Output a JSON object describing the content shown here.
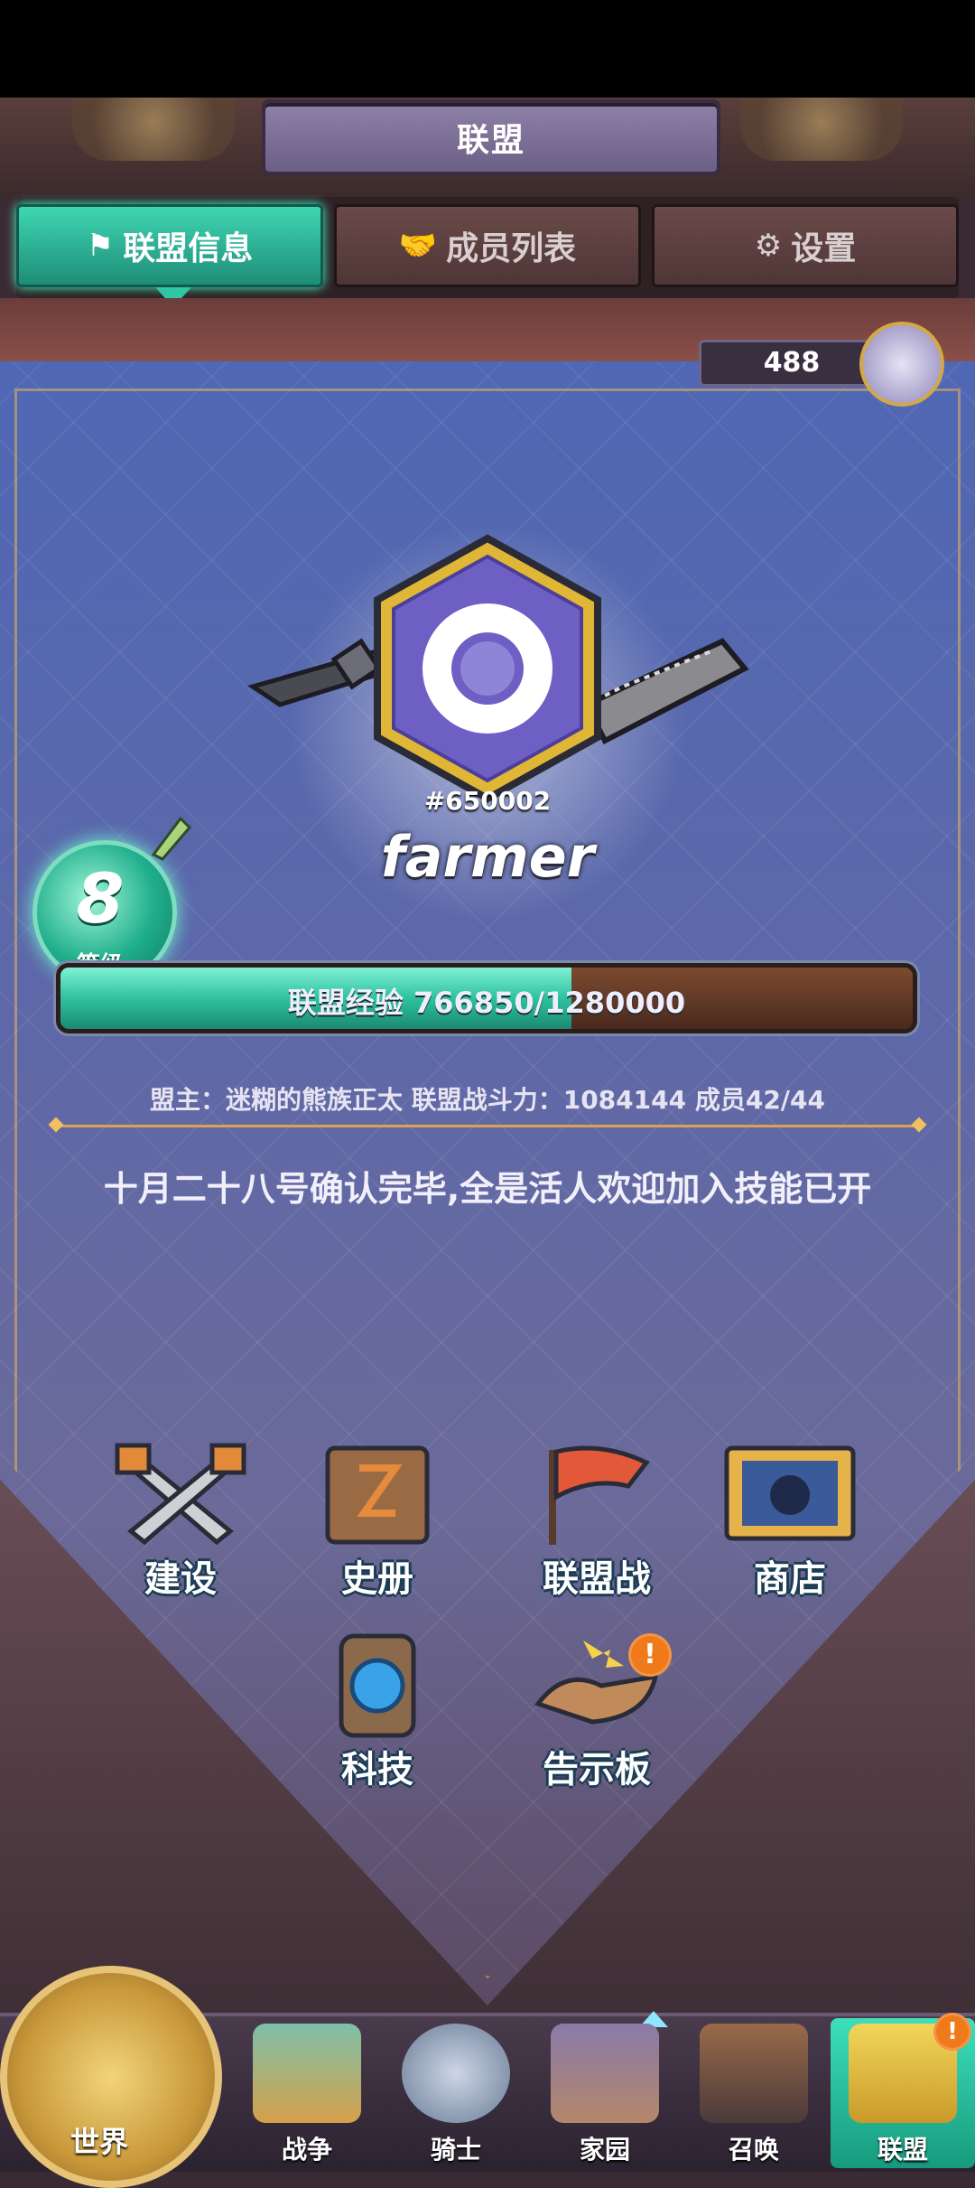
{
  "header": {
    "title": "联盟"
  },
  "tabs": [
    {
      "label": "联盟信息",
      "icon": "flag-icon",
      "active": true
    },
    {
      "label": "成员列表",
      "icon": "handshake-icon",
      "active": false
    },
    {
      "label": "设置",
      "icon": "gear-icon",
      "active": false
    }
  ],
  "score": {
    "value": "488"
  },
  "alliance": {
    "emblem_id": "#650002",
    "name": "farmer",
    "level": "8",
    "level_label": "等级",
    "xp_label": "联盟经验 766850/1280000",
    "xp_current": 766850,
    "xp_max": 1280000,
    "info_line": "盟主：迷糊的熊族正太  联盟战斗力：1084144  成员42/44",
    "announcement": "十月二十八号确认完毕,全是活人欢迎加入技能已开"
  },
  "features": [
    {
      "label": "建设",
      "icon": "build-tools-icon"
    },
    {
      "label": "史册",
      "icon": "history-book-icon"
    },
    {
      "label": "联盟战",
      "icon": "war-flag-icon"
    },
    {
      "label": "商店",
      "icon": "shop-icon"
    },
    {
      "label": "科技",
      "icon": "tech-gear-icon"
    },
    {
      "label": "告示板",
      "icon": "notice-handshake-icon",
      "alert": "!"
    }
  ],
  "nav": [
    {
      "label": "世界",
      "icon": "compass-icon"
    },
    {
      "label": "战争",
      "icon": "war-map-icon"
    },
    {
      "label": "骑士",
      "icon": "knight-icon"
    },
    {
      "label": "家园",
      "icon": "home-castle-icon"
    },
    {
      "label": "召唤",
      "icon": "train-icon"
    },
    {
      "label": "联盟",
      "icon": "alliance-trophy-icon",
      "active": true,
      "alert": "!"
    }
  ],
  "colors": {
    "accent": "#2ec2a0",
    "panel": "#5e68a8",
    "gold": "#d8a54a",
    "alert": "#f07a1a"
  }
}
